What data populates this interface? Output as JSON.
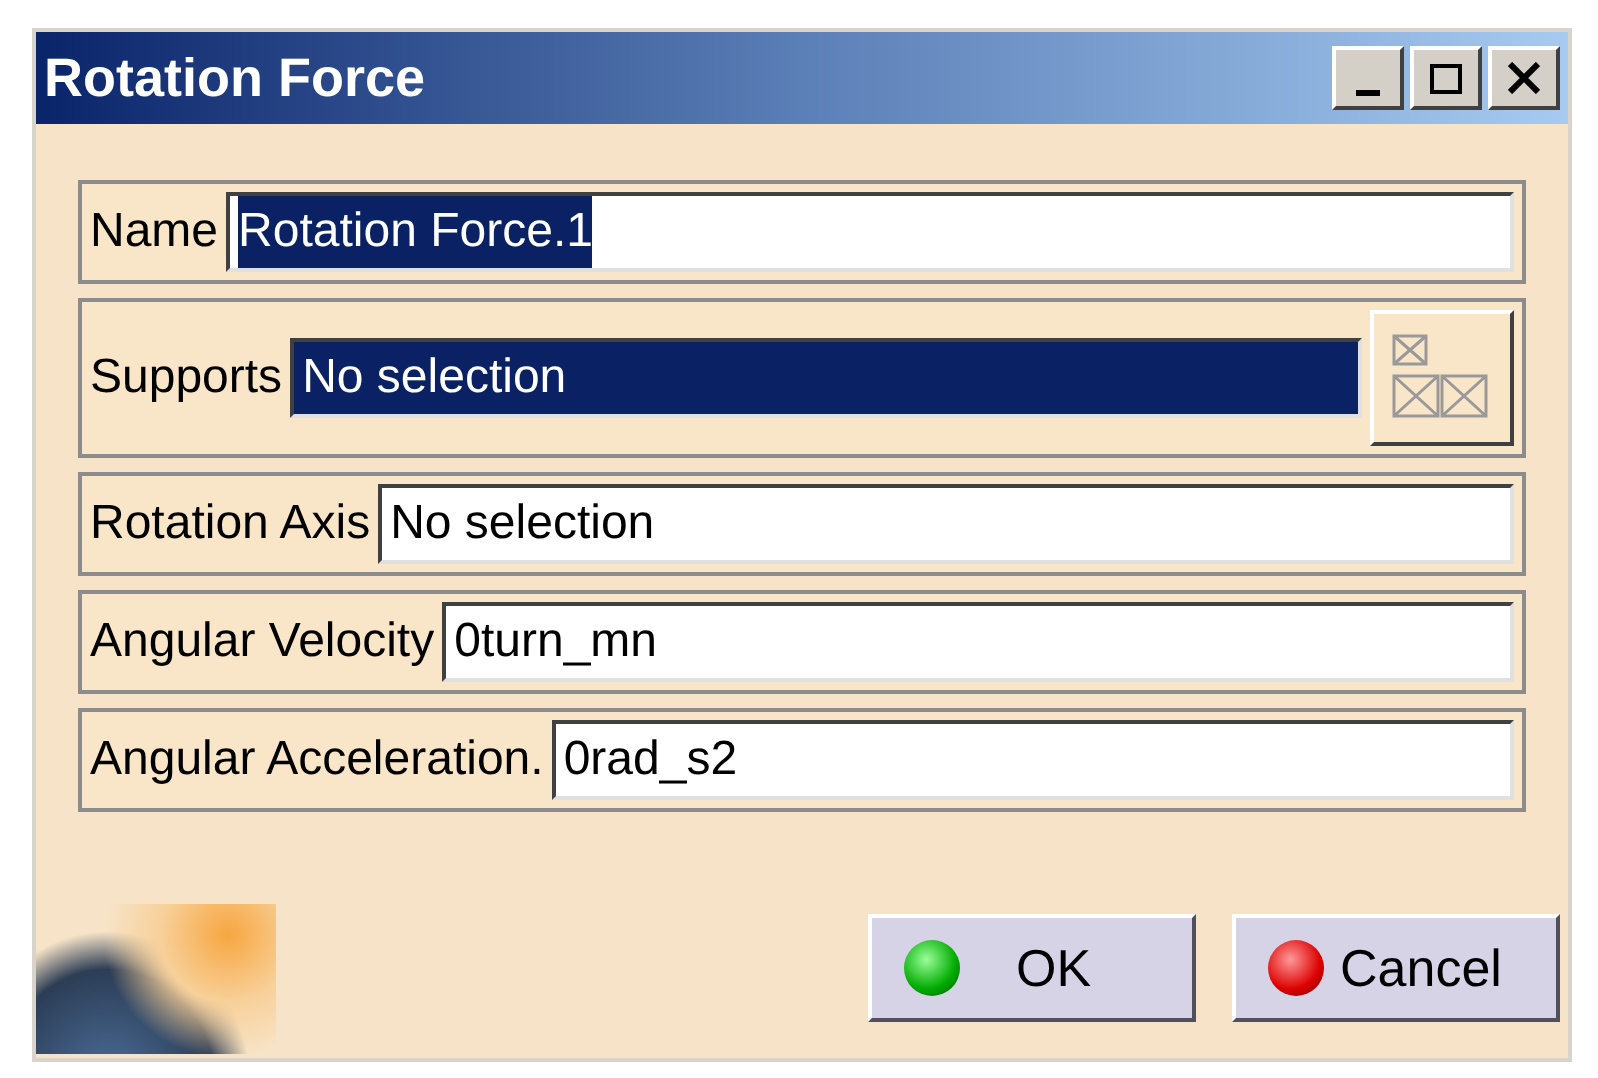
{
  "window": {
    "title": "Rotation Force"
  },
  "fields": [
    {
      "label": "Name",
      "value": "Rotation Force.1",
      "selected": true,
      "kind": "text"
    },
    {
      "label": "Supports",
      "value": "No selection",
      "selected": true,
      "kind": "selector"
    },
    {
      "label": "Rotation Axis",
      "value": "No selection",
      "selected": false,
      "kind": "text"
    },
    {
      "label": "Angular Velocity",
      "value": "0turn_mn",
      "selected": false,
      "kind": "text"
    },
    {
      "label": "Angular Acceleration.",
      "value": "0rad_s2",
      "selected": false,
      "kind": "text"
    }
  ],
  "buttons": [
    {
      "label": "OK",
      "kind": "ok"
    },
    {
      "label": "Cancel",
      "kind": "cancel"
    }
  ]
}
